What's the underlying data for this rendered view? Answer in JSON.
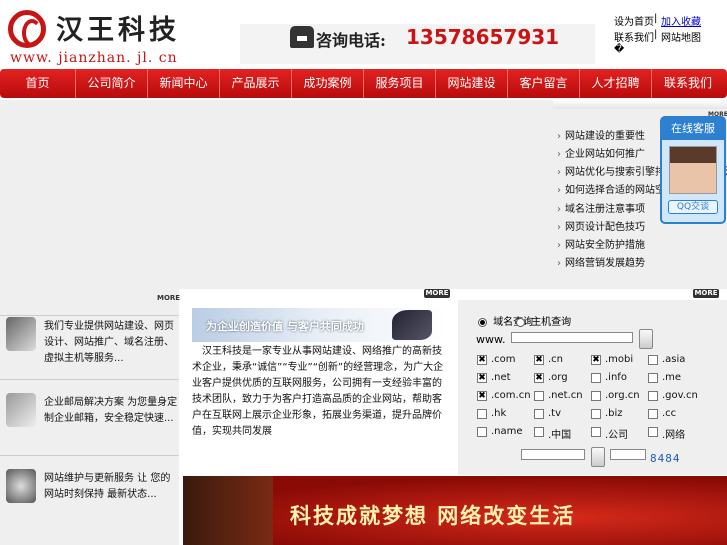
{
  "header": {
    "logo_cn": "汉王科技",
    "logo_url": "www. jianzhan. jl. cn",
    "phone_label": "咨询电话:",
    "phone_number": "13578657931",
    "top_links": {
      "row1_left": "设为首页",
      "row1_right": "加入收藏",
      "row2_left": "联系我们",
      "row2_right": "网站地图",
      "row3": "�"
    }
  },
  "nav": {
    "items": [
      "首页",
      "公司简介",
      "新闻中心",
      "产品展示",
      "成功案例",
      "服务项目",
      "网站建设",
      "客户留言",
      "人才招聘",
      "联系我们"
    ]
  },
  "news": {
    "items": [
      "网站建设的重要性",
      "企业网站如何推广",
      "网站优化与搜索引擎排名技巧分享交流方法",
      "如何选择合适的网站空间",
      "域名注册注意事项",
      "网页设计配色技巧",
      "网站安全防护措施",
      "网络营销发展趋势"
    ]
  },
  "online_service": {
    "title": "在线客服",
    "button": "QQ交谈"
  },
  "more_label": "MORE",
  "left_column": {
    "items": [
      {
        "text": "我们专业提供网站建设、网页设计、网站推广、域名注册、虚拟主机等服务..."
      },
      {
        "text": "企业邮局解决方案 为您量身定制企业邮箱，安全稳定快速..."
      },
      {
        "text": "网站维护与更新服务 让 您的网站时刻保持 最新状态..."
      }
    ]
  },
  "center": {
    "banner_text": "为企业创造价值 与客户共同成功",
    "body": "汉王科技是一家专业从事网站建设、网络推广的高新技术企业，秉承“诚信”“专业”“创新”的经营理念，为广大企业客户提供优质的互联网服务，公司拥有一支经验丰富的技术团队，致力于为客户打造高品质的企业网站，帮助客户在互联网上展示企业形象，拓展业务渠道，提升品牌价值，实现共同发展"
  },
  "domain_search": {
    "radio_options": [
      {
        "label": "域名查询",
        "checked": true
      },
      {
        "label": "主机查询",
        "checked": false
      }
    ],
    "www_prefix": "www.",
    "tlds": [
      {
        "label": ".com",
        "checked": true
      },
      {
        "label": ".cn",
        "checked": true
      },
      {
        "label": ".mobi",
        "checked": true
      },
      {
        "label": ".asia",
        "checked": false
      },
      {
        "label": ".net",
        "checked": true
      },
      {
        "label": ".org",
        "checked": true
      },
      {
        "label": ".info",
        "checked": false
      },
      {
        "label": ".me",
        "checked": false
      },
      {
        "label": ".com.cn",
        "checked": true
      },
      {
        "label": ".net.cn",
        "checked": false
      },
      {
        "label": ".org.cn",
        "checked": false
      },
      {
        "label": ".gov.cn",
        "checked": false
      },
      {
        "label": ".hk",
        "checked": false
      },
      {
        "label": ".tv",
        "checked": false
      },
      {
        "label": ".biz",
        "checked": false
      },
      {
        "label": ".cc",
        "checked": false
      },
      {
        "label": ".name",
        "checked": false
      },
      {
        "label": ".中国",
        "checked": false
      },
      {
        "label": ".公司",
        "checked": false
      },
      {
        "label": ".网络",
        "checked": false
      }
    ],
    "captcha": "8484"
  },
  "bottom_banner": {
    "slogan": "科技成就梦想  网络改变生活"
  },
  "colors": {
    "brand_red": "#c81414",
    "nav_red": "#d21a1a",
    "qq_blue": "#2d7fd0"
  }
}
